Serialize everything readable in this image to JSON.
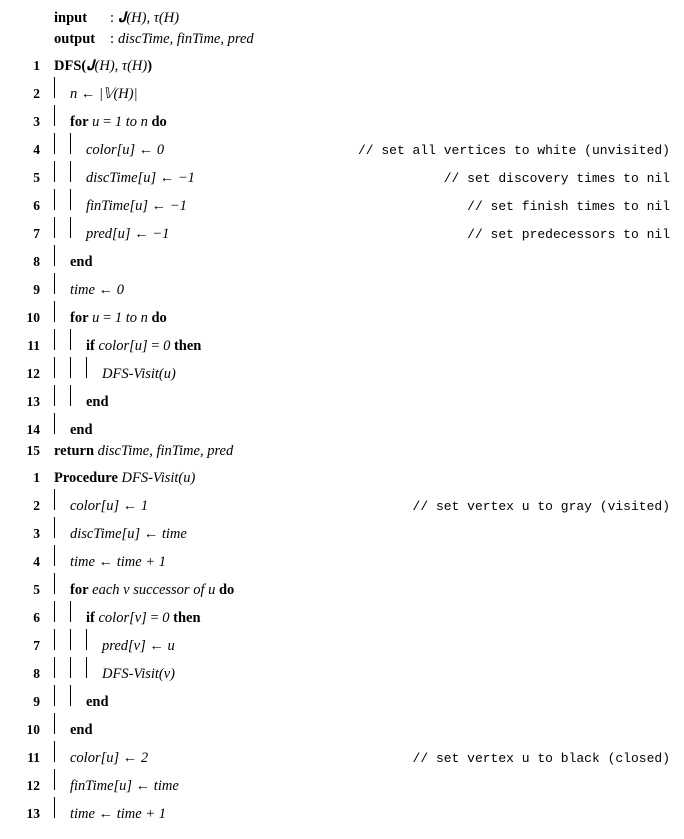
{
  "io": {
    "input_label": "input",
    "input_text": "𝐉(H), τ(H)",
    "output_label": "output",
    "output_text": "discTime, finTime, pred"
  },
  "block1": [
    {
      "n": "1",
      "bars": 0,
      "code_html": "<b>DFS(</b>𝐉(H), τ(H)<b>)</b>",
      "comment": ""
    },
    {
      "n": "2",
      "bars": 1,
      "code_html": "n <span class='sym'>←</span> |𝕍(H)|",
      "comment": ""
    },
    {
      "n": "3",
      "bars": 1,
      "code_html": "<b>for</b> u <span class='sym'>=</span> 1 to n <b>do</b>",
      "comment": ""
    },
    {
      "n": "4",
      "bars": 2,
      "code_html": "color[u] <span class='sym'>←</span> 0",
      "comment": "// set all vertices to white (unvisited)"
    },
    {
      "n": "5",
      "bars": 2,
      "code_html": "discTime[u] <span class='sym'>←</span> −1",
      "comment": "// set discovery times to nil"
    },
    {
      "n": "6",
      "bars": 2,
      "code_html": "finTime[u] <span class='sym'>←</span> −1",
      "comment": "// set finish times to nil"
    },
    {
      "n": "7",
      "bars": 2,
      "code_html": "pred[u] <span class='sym'>←</span> −1",
      "comment": "// set predecessors to nil"
    },
    {
      "n": "8",
      "bars": 1,
      "code_html": "<b>end</b>",
      "comment": ""
    },
    {
      "n": "9",
      "bars": 1,
      "code_html": "time <span class='sym'>←</span> 0",
      "comment": ""
    },
    {
      "n": "10",
      "bars": 1,
      "code_html": "<b>for</b> u <span class='sym'>=</span> 1 to n <b>do</b>",
      "comment": ""
    },
    {
      "n": "11",
      "bars": 2,
      "code_html": "<b>if</b> color[u] <span class='sym'>=</span> 0 <b>then</b>",
      "comment": ""
    },
    {
      "n": "12",
      "bars": 3,
      "code_html": "DFS-Visit(u)",
      "comment": ""
    },
    {
      "n": "13",
      "bars": 2,
      "code_html": "<b>end</b>",
      "comment": ""
    },
    {
      "n": "14",
      "bars": 1,
      "code_html": "<b>end</b>",
      "comment": ""
    },
    {
      "n": "15",
      "bars": 0,
      "code_html": "<b>return</b> discTime, finTime, pred",
      "comment": ""
    }
  ],
  "block2": [
    {
      "n": "1",
      "bars": 0,
      "code_html": "<b>Procedure</b> DFS-Visit(u)",
      "comment": ""
    },
    {
      "n": "2",
      "bars": 1,
      "code_html": "color[u] <span class='sym'>←</span> 1",
      "comment": "// set vertex u to gray (visited)"
    },
    {
      "n": "3",
      "bars": 1,
      "code_html": "discTime[u] <span class='sym'>←</span> time",
      "comment": ""
    },
    {
      "n": "4",
      "bars": 1,
      "code_html": "time <span class='sym'>←</span> time + 1",
      "comment": ""
    },
    {
      "n": "5",
      "bars": 1,
      "code_html": "<b>for</b>  each v successor of u <b>do</b>",
      "comment": ""
    },
    {
      "n": "6",
      "bars": 2,
      "code_html": "<b>if</b> color[v] <span class='sym'>=</span> 0 <b>then</b>",
      "comment": ""
    },
    {
      "n": "7",
      "bars": 3,
      "code_html": "pred[v] <span class='sym'>←</span> u",
      "comment": ""
    },
    {
      "n": "8",
      "bars": 3,
      "code_html": "DFS-Visit(v)",
      "comment": ""
    },
    {
      "n": "9",
      "bars": 2,
      "code_html": "<b>end</b>",
      "comment": ""
    },
    {
      "n": "10",
      "bars": 1,
      "code_html": "<b>end</b>",
      "comment": ""
    },
    {
      "n": "11",
      "bars": 1,
      "code_html": "color[u] <span class='sym'>←</span> 2",
      "comment": "// set vertex u to black (closed)"
    },
    {
      "n": "12",
      "bars": 1,
      "code_html": "finTime[u] <span class='sym'>←</span> time",
      "comment": ""
    },
    {
      "n": "13",
      "bars": 1,
      "code_html": "time <span class='sym'>←</span> time + 1",
      "comment": ""
    }
  ]
}
